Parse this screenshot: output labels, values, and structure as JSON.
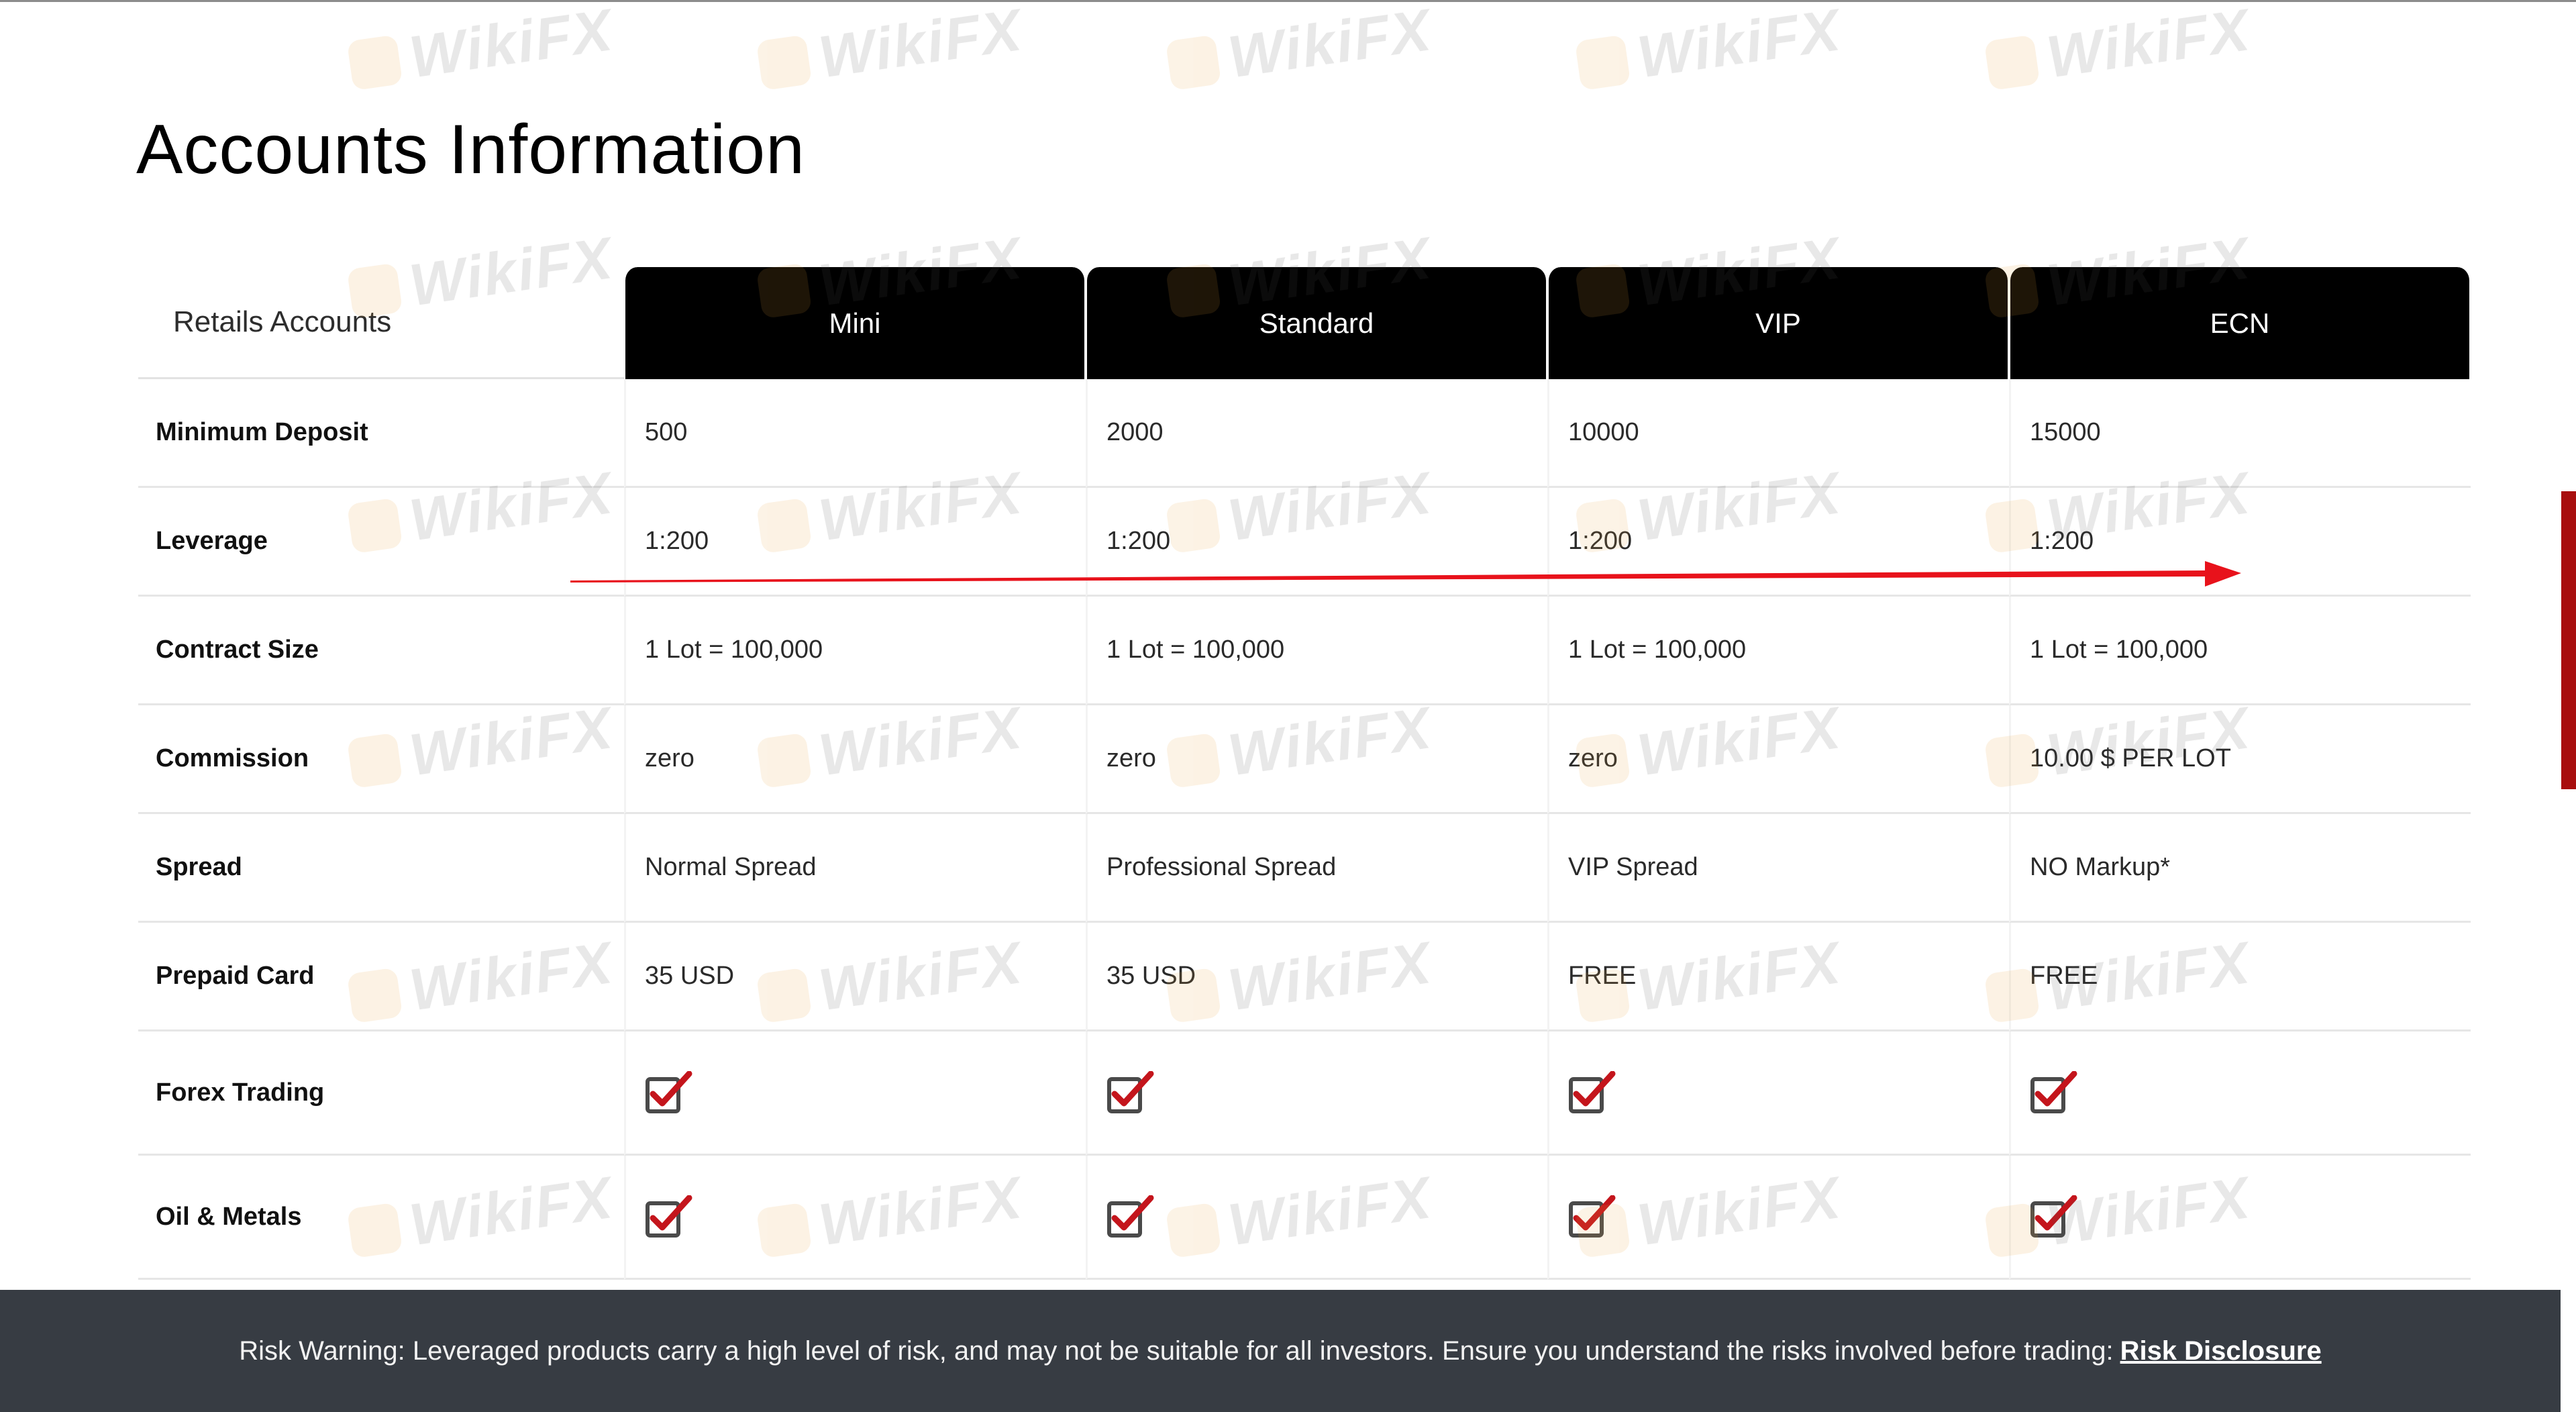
{
  "page": {
    "title": "Accounts Information"
  },
  "table": {
    "corner_label": "Retails Accounts",
    "plans": [
      "Mini",
      "Standard",
      "VIP",
      "ECN"
    ],
    "rows": [
      {
        "label": "Minimum Deposit",
        "values": [
          "500",
          "2000",
          "10000",
          "15000"
        ]
      },
      {
        "label": "Leverage",
        "values": [
          "1:200",
          "1:200",
          "1:200",
          "1:200"
        ]
      },
      {
        "label": "Contract Size",
        "values": [
          "1 Lot = 100,000",
          "1 Lot = 100,000",
          "1 Lot = 100,000",
          "1 Lot = 100,000"
        ]
      },
      {
        "label": "Commission",
        "values": [
          "zero",
          "zero",
          "zero",
          "10.00 $ PER LOT"
        ]
      },
      {
        "label": "Spread",
        "values": [
          "Normal Spread",
          "Professional Spread",
          "VIP Spread",
          "NO Markup*"
        ]
      },
      {
        "label": "Prepaid Card",
        "values": [
          "35 USD",
          "35 USD",
          "FREE",
          "FREE"
        ]
      },
      {
        "label": "Forex Trading",
        "checks": [
          true,
          true,
          true,
          true
        ]
      },
      {
        "label": "Oil & Metals",
        "checks": [
          true,
          true,
          true,
          true
        ]
      }
    ]
  },
  "footer": {
    "risk_text": "Risk Warning: Leveraged products carry a high level of risk, and may not be suitable for all investors. Ensure you understand the risks involved before trading:",
    "risk_link": "Risk Disclosure"
  },
  "watermark": {
    "text": "WikiFX"
  },
  "icons": {
    "check": "checked-box-icon",
    "arrow": "red-arrow-annotation"
  },
  "colors": {
    "header_bg": "#000000",
    "header_text": "#ffffff",
    "check_red": "#c4151c",
    "check_box": "#4a4a4a",
    "footer_bg": "#373c43",
    "arrow_red": "#e8121b",
    "side_bar": "#a80f0f"
  }
}
